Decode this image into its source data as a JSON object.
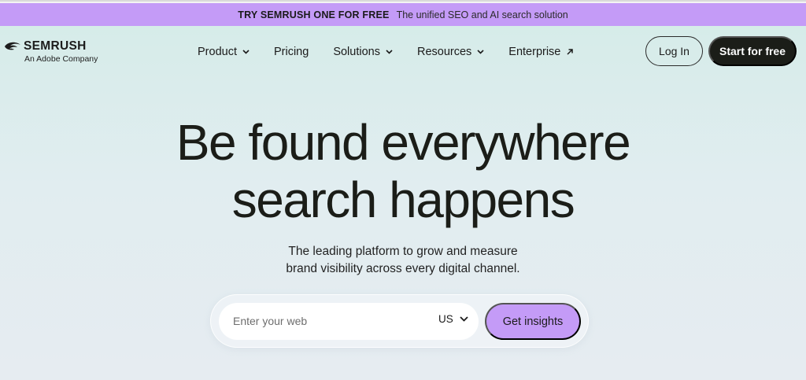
{
  "promo": {
    "cta": "TRY SEMRUSH ONE FOR FREE",
    "text": "The unified SEO and AI search solution",
    "color": "#c49bf7"
  },
  "header": {
    "logo_text": "SEMRUSH",
    "logo_subtitle": "An Adobe Company",
    "nav": [
      {
        "label": "Product",
        "icon": "chevron-down-icon"
      },
      {
        "label": "Pricing"
      },
      {
        "label": "Solutions",
        "icon": "chevron-down-icon"
      },
      {
        "label": "Resources",
        "icon": "chevron-down-icon"
      },
      {
        "label": "Enterprise",
        "icon": "external-arrow-icon"
      }
    ],
    "login_label": "Log In",
    "start_label": "Start for free"
  },
  "hero": {
    "headline_line1": "Be found everywhere",
    "headline_line2": "search happens",
    "subhead_line1": "The leading platform to grow and measure",
    "subhead_line2": "brand visibility across every digital channel."
  },
  "search": {
    "placeholder": "Enter your web",
    "value": "",
    "country": "US",
    "button_label": "Get insights"
  },
  "colors": {
    "accent": "#c49bf7",
    "dark": "#1b1d18",
    "hero_bg_top": "#d6ece9",
    "hero_bg_bottom": "#e6ecf1"
  }
}
